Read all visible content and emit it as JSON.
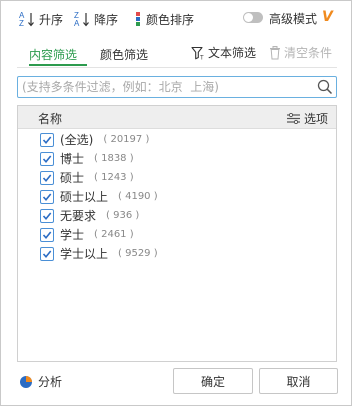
{
  "sort": {
    "asc_label": "升序",
    "desc_label": "降序",
    "color_label": "颜色排序",
    "advanced_label": "高级模式",
    "vip_label": "V"
  },
  "tabs": {
    "content_filter": "内容筛选",
    "color_filter": "颜色筛选",
    "text_filter": "文本筛选",
    "clear": "清空条件"
  },
  "search": {
    "placeholder": "(支持多条件过滤，例如：北京  上海)"
  },
  "list": {
    "header_name": "名称",
    "header_options": "选项",
    "items": [
      {
        "name": "(全选)",
        "count": "( 20197 )"
      },
      {
        "name": "博士",
        "count": "( 1838 )"
      },
      {
        "name": "硕士",
        "count": "( 1243 )"
      },
      {
        "name": "硕士以上",
        "count": "( 4190 )"
      },
      {
        "name": "无要求",
        "count": "( 936 )"
      },
      {
        "name": "学士",
        "count": "( 2461 )"
      },
      {
        "name": "学士以上",
        "count": "( 9529 )"
      }
    ]
  },
  "footer": {
    "analysis_label": "分析",
    "ok_label": "确定",
    "cancel_label": "取消"
  },
  "colors": {
    "accent_green": "#2d9b4e",
    "checkbox_blue": "#4a8fd6",
    "vip_orange": "#f08a1e"
  }
}
